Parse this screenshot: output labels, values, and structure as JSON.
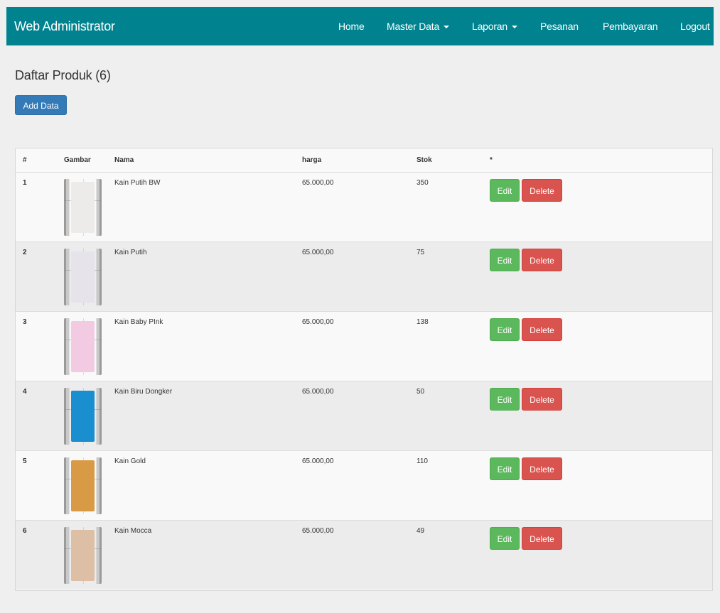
{
  "navbar": {
    "brand": "Web Administrator",
    "items": [
      {
        "label": "Home"
      },
      {
        "label": "Master Data"
      },
      {
        "label": "Laporan"
      },
      {
        "label": "Pesanan"
      },
      {
        "label": "Pembayaran"
      },
      {
        "label": "Logout"
      }
    ]
  },
  "main": {
    "title": "Daftar Produk (6)",
    "add_button": "Add Data"
  },
  "table": {
    "columns": [
      "#",
      "Gambar",
      "Nama",
      "harga",
      "Stok",
      "*"
    ],
    "edit_label": "Edit",
    "delete_label": "Delete",
    "rows": [
      {
        "no": "1",
        "nama": "Kain Putih BW",
        "harga": "65.000,00",
        "stok": "350",
        "color": "#ecebea"
      },
      {
        "no": "2",
        "nama": "Kain Putih",
        "harga": "65.000,00",
        "stok": "75",
        "color": "#e6e3ea"
      },
      {
        "no": "3",
        "nama": "Kain Baby PInk",
        "harga": "65.000,00",
        "stok": "138",
        "color": "#f2cbe3"
      },
      {
        "no": "4",
        "nama": "Kain Biru Dongker",
        "harga": "65.000,00",
        "stok": "50",
        "color": "#1a8fd0"
      },
      {
        "no": "5",
        "nama": "Kain Gold",
        "harga": "65.000,00",
        "stok": "110",
        "color": "#d99a45"
      },
      {
        "no": "6",
        "nama": "Kain Mocca",
        "harga": "65.000,00",
        "stok": "49",
        "color": "#dcbfa5"
      }
    ]
  }
}
